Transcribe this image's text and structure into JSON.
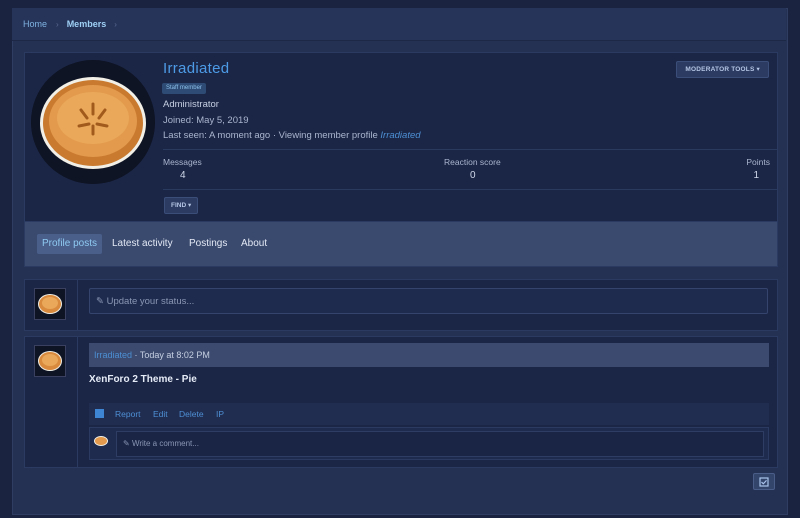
{
  "breadcrumb": {
    "items": [
      "Home",
      "Members"
    ]
  },
  "profile": {
    "username": "Irradiated",
    "badge": "Staff member",
    "role": "Administrator",
    "joined": "Joined: May 5, 2019",
    "last_seen_prefix": "Last seen: A moment ago · Viewing member profile",
    "last_seen_link": "Irradiated",
    "moderator_tools_label": "MODERATOR TOOLS",
    "find_label": "FIND",
    "stats": [
      {
        "label": "Messages",
        "value": "4"
      },
      {
        "label": "Reaction score",
        "value": "0"
      },
      {
        "label": "Points",
        "value": "1"
      }
    ]
  },
  "tabs": [
    "Profile posts",
    "Latest activity",
    "Postings",
    "About"
  ],
  "active_tab": "Profile posts",
  "status_placeholder": "Update your status...",
  "post": {
    "author": "Irradiated",
    "time": "Today at 8:02 PM",
    "body": "XenForo 2 Theme - Pie",
    "actions": [
      "Report",
      "Edit",
      "Delete",
      "IP"
    ],
    "comment_placeholder": "Write a comment..."
  },
  "colors": {
    "accent": "#4d9be6",
    "background": "#1a2440",
    "panel": "#1b2646",
    "tab_bar": "#3a4a6e"
  }
}
